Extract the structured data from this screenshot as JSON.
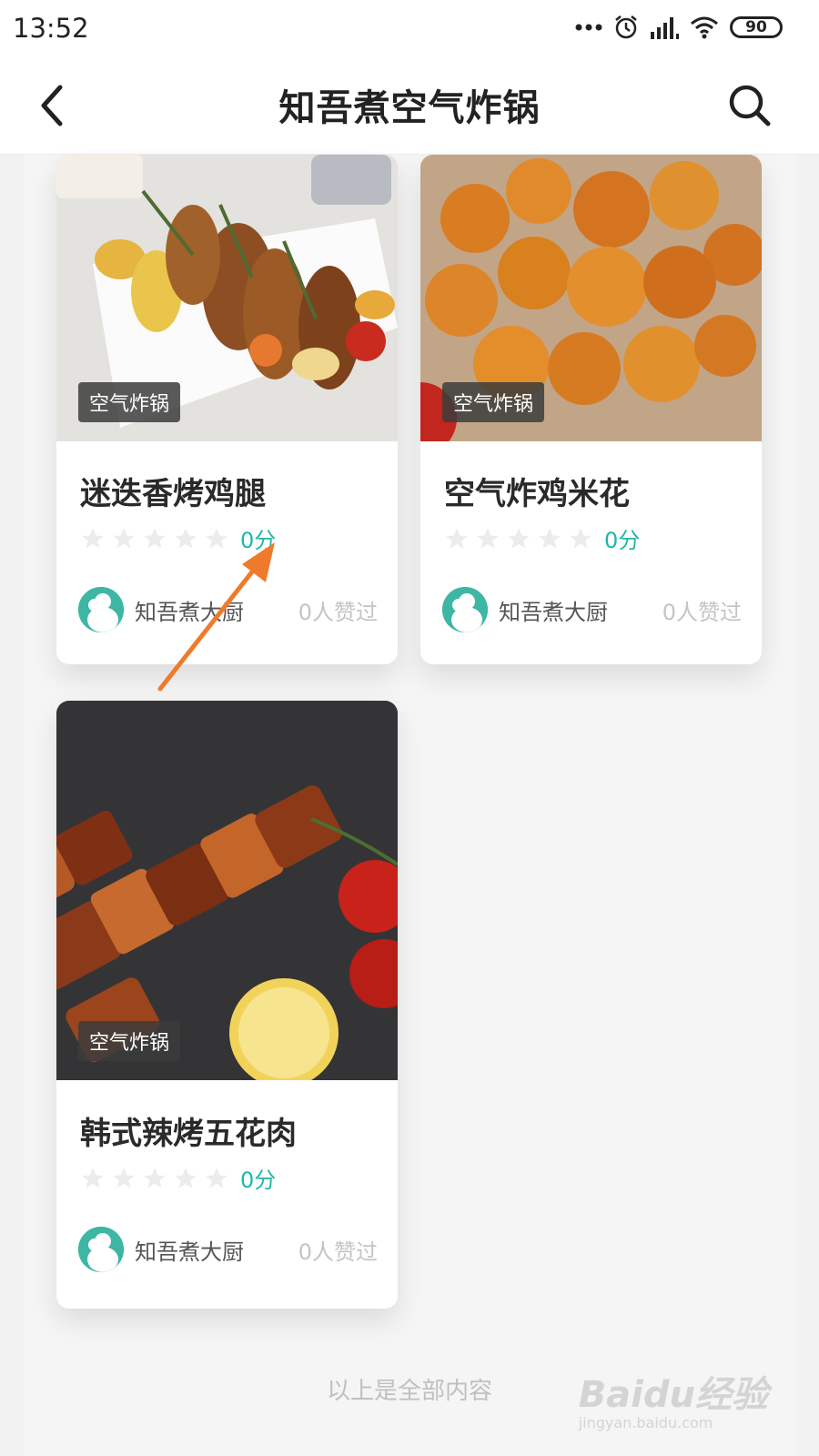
{
  "status": {
    "time": "13:52",
    "battery": "90"
  },
  "header": {
    "title": "知吾煮空气炸锅"
  },
  "cards": [
    {
      "tag": "空气炸锅",
      "title": "迷迭香烤鸡腿",
      "score": "0分",
      "rating": 0,
      "author": "知吾煮大厨",
      "likes": "0人赞过"
    },
    {
      "tag": "空气炸锅",
      "title": "空气炸鸡米花",
      "score": "0分",
      "rating": 0,
      "author": "知吾煮大厨",
      "likes": "0人赞过"
    },
    {
      "tag": "空气炸锅",
      "title": "韩式辣烤五花肉",
      "score": "0分",
      "rating": 0,
      "author": "知吾煮大厨",
      "likes": "0人赞过"
    }
  ],
  "footer": {
    "note": "以上是全部内容"
  },
  "watermark": {
    "brand": "Baidu经验",
    "url": "jingyan.baidu.com"
  },
  "colors": {
    "accent": "#1fb8a8",
    "arrow": "#f07a2c"
  }
}
